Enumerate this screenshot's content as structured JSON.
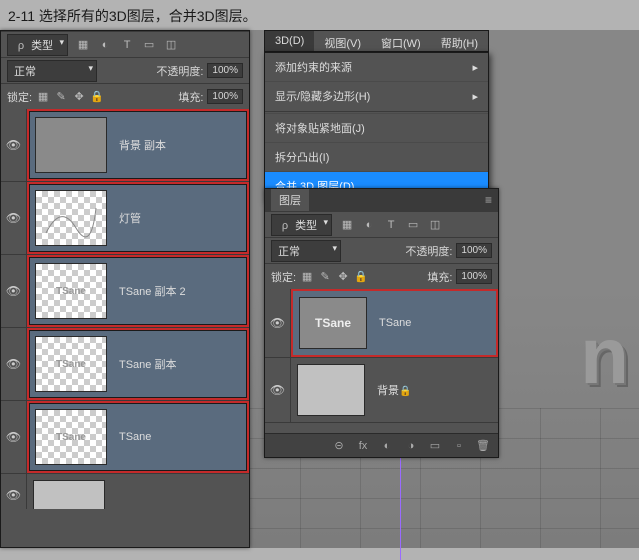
{
  "caption": "2-11 选择所有的3D图层，合并3D图层。",
  "menubar": {
    "items": [
      {
        "label": "3D(D)"
      },
      {
        "label": "视图(V)"
      },
      {
        "label": "窗口(W)"
      },
      {
        "label": "帮助(H)"
      }
    ]
  },
  "dropdown": {
    "items": [
      {
        "label": "添加约束的来源",
        "submenu": true
      },
      {
        "label": "显示/隐藏多边形(H)",
        "submenu": true
      },
      {
        "label": "将对象贴紧地面(J)"
      },
      {
        "label": "拆分凸出(I)"
      },
      {
        "label": "合并 3D 图层(D)",
        "highlight": true
      }
    ]
  },
  "left_panel": {
    "filter_label": "类型",
    "blend_mode": "正常",
    "opacity_label": "不透明度:",
    "opacity_value": "100%",
    "lock_label": "锁定:",
    "fill_label": "填充:",
    "fill_value": "100%",
    "layers": [
      {
        "name": "背景 副本",
        "thumb": "gray",
        "selected": true
      },
      {
        "name": "灯管",
        "thumb": "checker-line",
        "selected": true
      },
      {
        "name": "TSane 副本 2",
        "thumb": "checker-text",
        "selected": true
      },
      {
        "name": "TSane 副本",
        "thumb": "checker-text",
        "selected": true
      },
      {
        "name": "TSane",
        "thumb": "checker-text",
        "selected": true
      }
    ]
  },
  "right_panel": {
    "tab_title": "图层",
    "filter_label": "类型",
    "blend_mode": "正常",
    "opacity_label": "不透明度:",
    "opacity_value": "100%",
    "lock_label": "锁定:",
    "fill_label": "填充:",
    "fill_value": "100%",
    "layers": [
      {
        "name": "TSane",
        "thumb_text": "TSane",
        "selected": true
      },
      {
        "name": "背景",
        "locked": true
      }
    ]
  },
  "icons": {
    "search": "ρ",
    "eye": "👁",
    "chain": "⊕",
    "fx": "fx",
    "mask": "◐",
    "folder": "📁",
    "new": "▫",
    "trash": "🗑"
  }
}
